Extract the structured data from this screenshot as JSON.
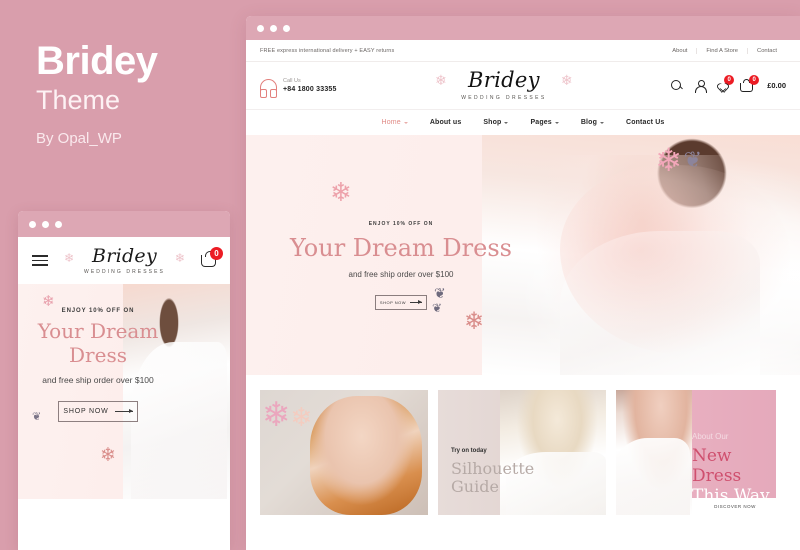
{
  "promo": {
    "title": "Bridey",
    "subtitle": "Theme",
    "author": "By Opal_WP"
  },
  "colors": {
    "background_pink": "#d99eac",
    "titlebar_pink": "#dda7b4",
    "accent_rose": "#d98e91",
    "badge_red": "#ec1c24",
    "nav_active": "#e08b86",
    "card3_heading": "#cf4f6e"
  },
  "desktop": {
    "titlebar_dots": 3,
    "topbar": {
      "message": "FREE express international delivery + EASY returns",
      "links": [
        "About",
        "Find A Store",
        "Contact"
      ]
    },
    "header": {
      "call_label": "Call Us",
      "call_number": "+84 1800 33355",
      "logo_brand": "Bridey",
      "logo_tagline": "WEDDING DRESSES",
      "wishlist_count": "0",
      "cart_count": "0",
      "cart_total": "£0.00"
    },
    "nav": [
      {
        "label": "Home",
        "has_dropdown": true,
        "active": true
      },
      {
        "label": "About us",
        "has_dropdown": false,
        "active": false
      },
      {
        "label": "Shop",
        "has_dropdown": true,
        "active": false
      },
      {
        "label": "Pages",
        "has_dropdown": true,
        "active": false
      },
      {
        "label": "Blog",
        "has_dropdown": true,
        "active": false
      },
      {
        "label": "Contact Us",
        "has_dropdown": false,
        "active": false
      }
    ],
    "hero": {
      "eyebrow": "ENJOY 10% OFF ON",
      "title": "Your Dream Dress",
      "subtitle": "and free ship order over $100",
      "button": "SHOP NOW"
    },
    "cards": [
      {
        "eyebrow": "",
        "title": "",
        "title_line2": "",
        "button": ""
      },
      {
        "eyebrow": "Try on today",
        "title": "Silhouette",
        "title_line2": "Guide",
        "button": ""
      },
      {
        "eyebrow": "About Our",
        "title": "New Dress",
        "title_line2": "This Way",
        "button": "DISCOVER NOW"
      }
    ]
  },
  "mobile": {
    "titlebar_dots": 3,
    "header": {
      "logo_brand": "Bridey",
      "logo_tagline": "WEDDING DRESSES",
      "cart_count": "0"
    },
    "hero": {
      "eyebrow": "ENJOY 10% OFF ON",
      "title_line1": "Your Dream",
      "title_line2": "Dress",
      "subtitle": "and free ship order over $100",
      "button": "SHOP NOW"
    }
  }
}
